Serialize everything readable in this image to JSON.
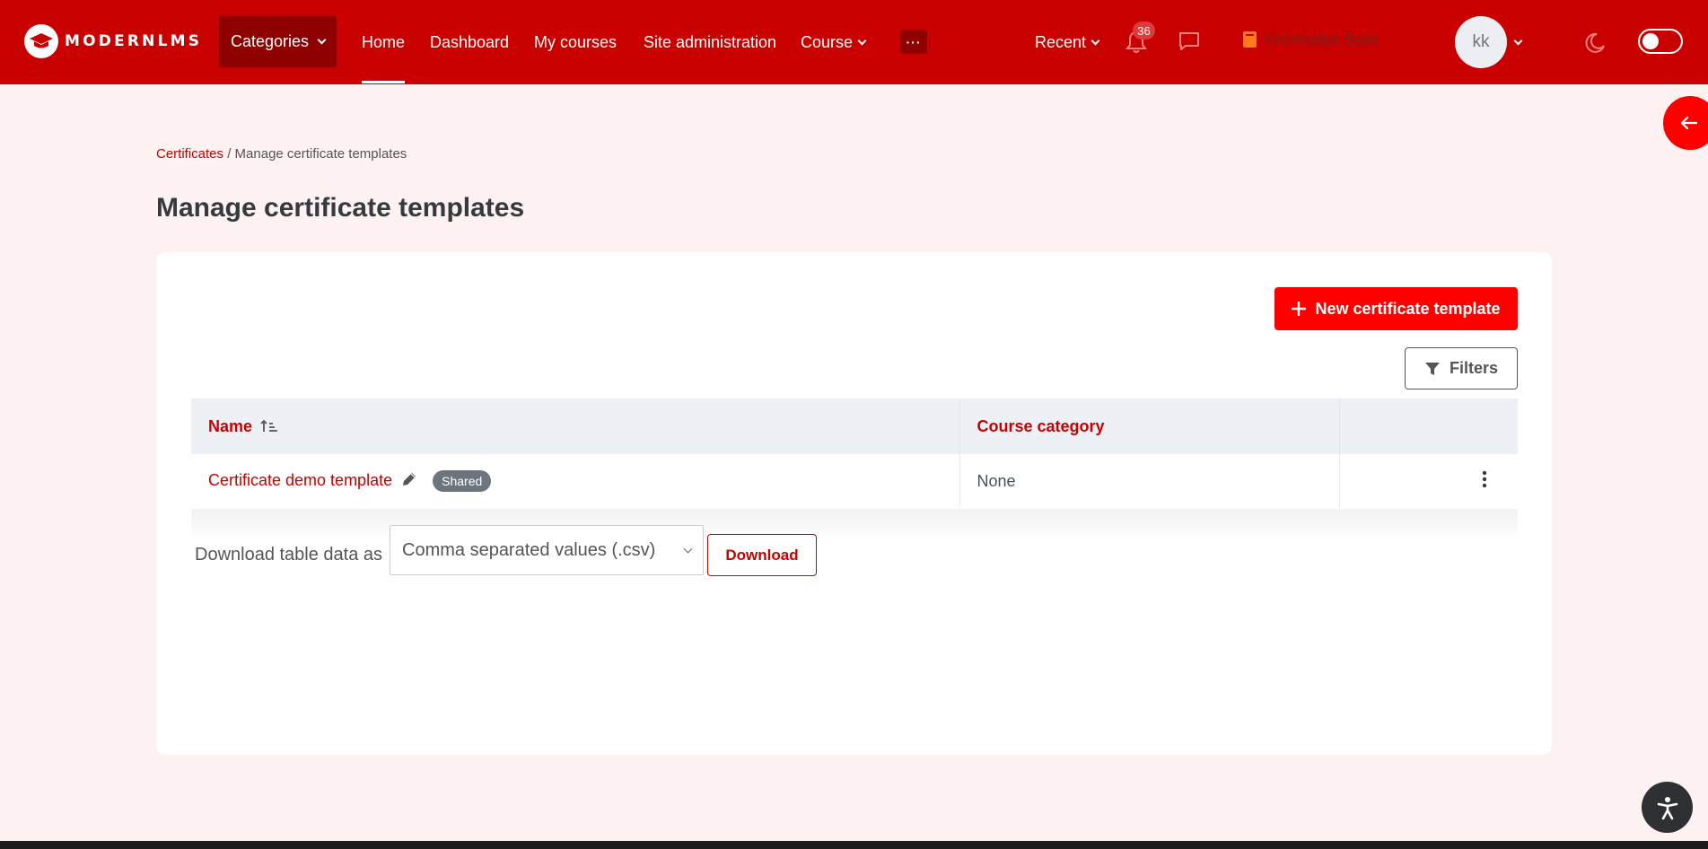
{
  "navbar": {
    "brand": "MODERNLMS",
    "categories": "Categories",
    "items": [
      "Home",
      "Dashboard",
      "My courses",
      "Site administration",
      "Course"
    ],
    "more": "···",
    "recent": "Recent",
    "notifications_count": "36",
    "knowledge_base": "Knowledge Base",
    "avatar_initials": "kk"
  },
  "breadcrumb": {
    "root": "Certificates",
    "separator": "/",
    "current": "Manage certificate templates"
  },
  "page": {
    "title": "Manage certificate templates",
    "new_button": "New certificate template",
    "filters_button": "Filters"
  },
  "table": {
    "columns": [
      "Name",
      "Course category",
      ""
    ],
    "rows": [
      {
        "name": "Certificate demo template",
        "badge": "Shared",
        "category": "None"
      }
    ]
  },
  "download": {
    "label": "Download table data as",
    "format": "Comma separated values (.csv)",
    "button": "Download"
  },
  "colors": {
    "brand": "#c90000",
    "accent": "#ff0000",
    "background": "#fdf2f1"
  },
  "icons": [
    "graduation-cap-icon",
    "chevron-down-icon",
    "bell-icon",
    "chat-icon",
    "book-icon",
    "moon-icon",
    "arrow-left-icon",
    "plus-icon",
    "filter-icon",
    "sort-ascending-icon",
    "pencil-icon",
    "kebab-menu-icon",
    "accessibility-icon"
  ]
}
